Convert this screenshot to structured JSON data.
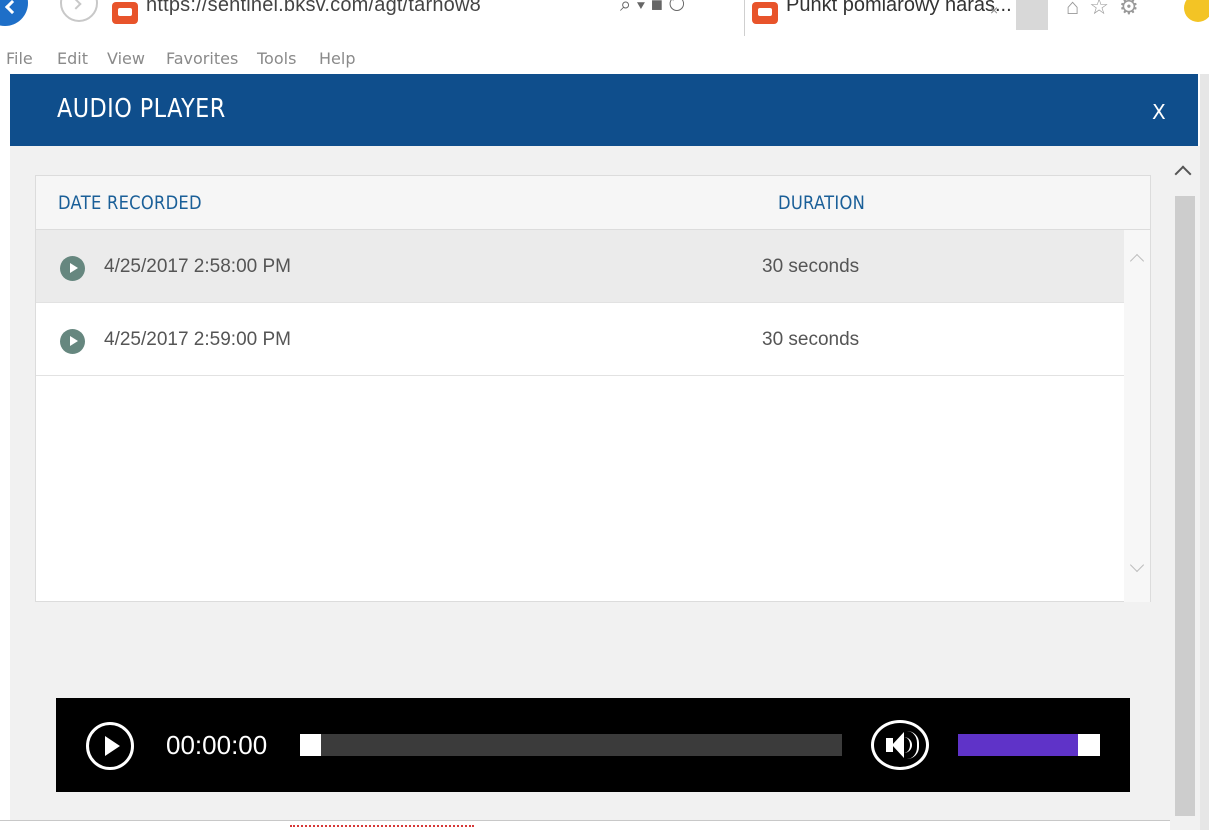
{
  "browser": {
    "address_url": "https://sentinel.bksv.com/agt/tarnow8",
    "address_icons": "⌕ ▾ ■ ↻",
    "tab_title": "Punkt pomiarowy naras...",
    "tab_close": "×",
    "toolbar_icons": "⌂☆⚙"
  },
  "menubar": {
    "items": [
      "File",
      "Edit",
      "View",
      "Favorites",
      "Tools",
      "Help"
    ]
  },
  "dialog": {
    "title": "AUDIO PLAYER",
    "close_label": "X"
  },
  "table": {
    "columns": [
      "DATE RECORDED",
      "DURATION"
    ],
    "rows": [
      {
        "date": "4/25/2017 2:58:00 PM",
        "duration": "30 seconds",
        "selected": true
      },
      {
        "date": "4/25/2017 2:59:00 PM",
        "duration": "30 seconds",
        "selected": false
      }
    ]
  },
  "player": {
    "time": "00:00:00",
    "progress": 0.0,
    "volume": 1.0,
    "colors": {
      "volume_fill": "#5f33c8",
      "background": "#000000"
    }
  },
  "colors": {
    "header_blue": "#0f4e8c",
    "column_header_text": "#1a5f98",
    "play_icon": "#66877f"
  },
  "icons": {
    "back": "back-arrow-icon",
    "forward": "forward-arrow-icon",
    "site": "site-favicon-icon",
    "row_play": "play-circle-icon",
    "player_play": "play-icon",
    "volume": "speaker-volume-icon",
    "scroll_up": "chevron-up-icon",
    "scroll_down": "chevron-down-icon"
  }
}
